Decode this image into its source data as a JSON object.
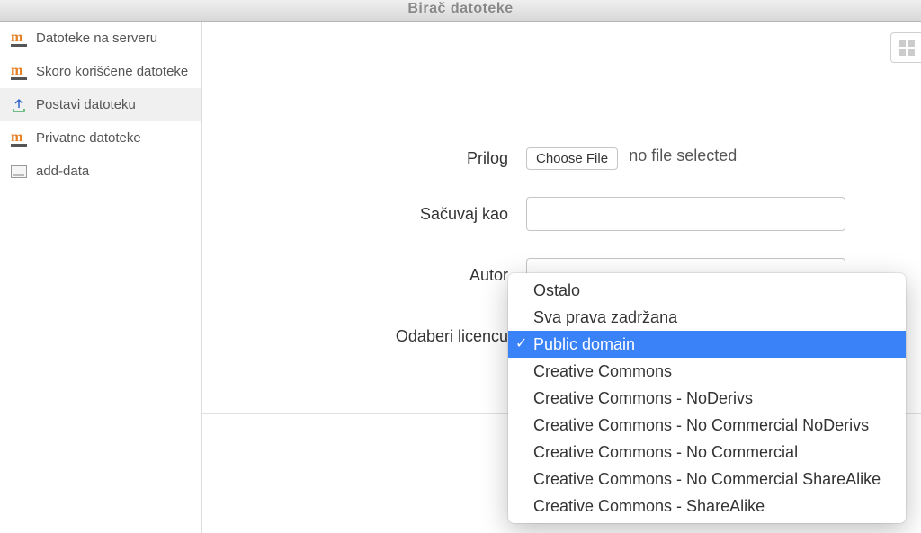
{
  "title": "Birač datoteke",
  "sidebar": {
    "items": [
      {
        "label": "Datoteke na serveru",
        "icon": "m-icon"
      },
      {
        "label": "Skoro korišćene datoteke",
        "icon": "m-icon"
      },
      {
        "label": "Postavi datoteku",
        "icon": "upload-icon",
        "active": true
      },
      {
        "label": "Privatne datoteke",
        "icon": "m-icon"
      },
      {
        "label": "add-data",
        "icon": "box-icon"
      }
    ]
  },
  "form": {
    "attachment_label": "Prilog",
    "choose_file_label": "Choose File",
    "no_file_text": "no file selected",
    "save_as_label": "Sačuvaj kao",
    "save_as_value": "",
    "author_label": "Autor",
    "author_value": "",
    "license_label": "Odaberi licencu"
  },
  "license_options": [
    "Ostalo",
    "Sva prava zadržana",
    "Public domain",
    "Creative Commons",
    "Creative Commons - NoDerivs",
    "Creative Commons - No Commercial NoDerivs",
    "Creative Commons - No Commercial",
    "Creative Commons - No Commercial ShareAlike",
    "Creative Commons - ShareAlike"
  ],
  "license_selected": "Public domain"
}
